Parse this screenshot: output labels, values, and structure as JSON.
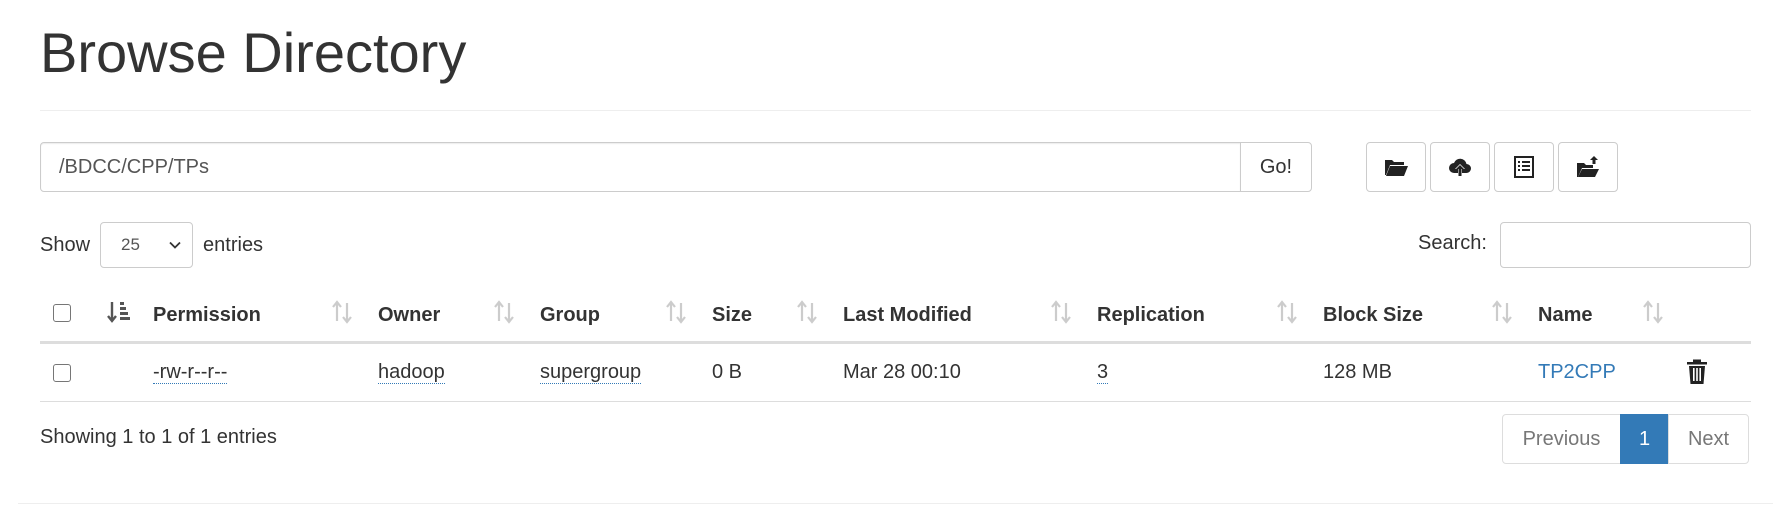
{
  "page": {
    "title": "Browse Directory"
  },
  "pathbar": {
    "path_value": "/BDCC/CPP/TPs",
    "go_label": "Go!",
    "tools": [
      {
        "icon": "folder-open-icon"
      },
      {
        "icon": "cloud-upload-icon"
      },
      {
        "icon": "list-alt-icon"
      },
      {
        "icon": "folder-move-icon"
      }
    ]
  },
  "entries": {
    "show_label": "Show",
    "selected": "25",
    "suffix": "entries"
  },
  "search": {
    "label": "Search:",
    "value": ""
  },
  "table": {
    "columns": [
      "Permission",
      "Owner",
      "Group",
      "Size",
      "Last Modified",
      "Replication",
      "Block Size",
      "Name"
    ],
    "rows": [
      {
        "permission": "-rw-r--r--",
        "owner": "hadoop",
        "group": "supergroup",
        "size": "0 B",
        "last_modified": "Mar 28 00:10",
        "replication": "3",
        "block_size": "128 MB",
        "name": "TP2CPP"
      }
    ]
  },
  "footer": {
    "info": "Showing 1 to 1 of 1 entries",
    "previous": "Previous",
    "current_page": "1",
    "next": "Next"
  },
  "colors": {
    "link": "#337ab7",
    "active_page": "#337ab7",
    "border": "#cccccc"
  }
}
